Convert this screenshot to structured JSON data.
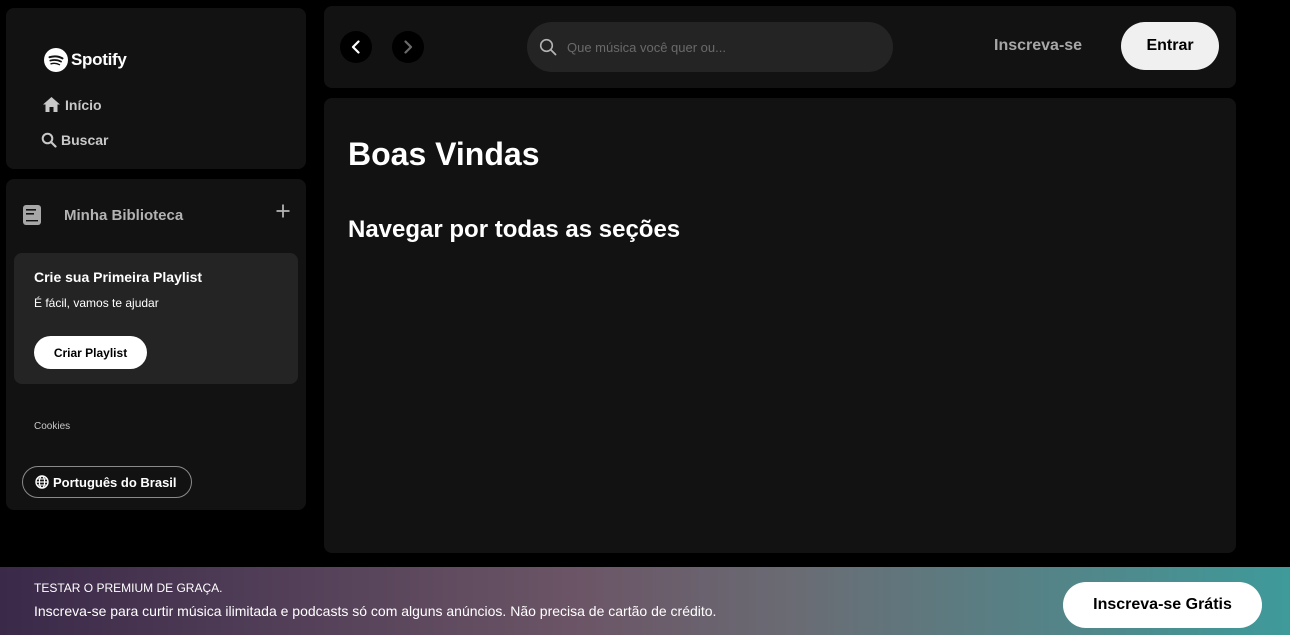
{
  "sidebar": {
    "logo_text": "Spotify",
    "nav": [
      {
        "label": "Início",
        "icon": "home-icon"
      },
      {
        "label": "Buscar",
        "icon": "search-icon"
      }
    ],
    "library": {
      "title": "Minha Biblioteca",
      "icon": "library-icon",
      "add_icon": "plus-icon"
    },
    "playlist_card": {
      "title": "Crie sua Primeira Playlist",
      "subtitle": "É fácil, vamos te ajudar",
      "button": "Criar Playlist"
    },
    "cookies_link": "Cookies",
    "language_button": "Português do Brasil"
  },
  "topbar": {
    "back_icon": "chevron-left-icon",
    "forward_icon": "chevron-right-icon",
    "search_placeholder": "Que música você quer ou...",
    "signup_link": "Inscreva-se",
    "login_button": "Entrar"
  },
  "main": {
    "title": "Boas Vindas",
    "section_title": "Navegar por todas as seções"
  },
  "banner": {
    "kicker": "TESTAR O PREMIUM DE GRAÇA.",
    "text": "Inscreva-se para curtir música ilimitada e podcasts só com alguns anúncios. Não precisa de cartão de crédito.",
    "button": "Inscreva-se Grátis"
  },
  "colors": {
    "background": "#000000",
    "panel": "#121212",
    "card": "#242424",
    "muted_text": "#a7a7a7"
  }
}
